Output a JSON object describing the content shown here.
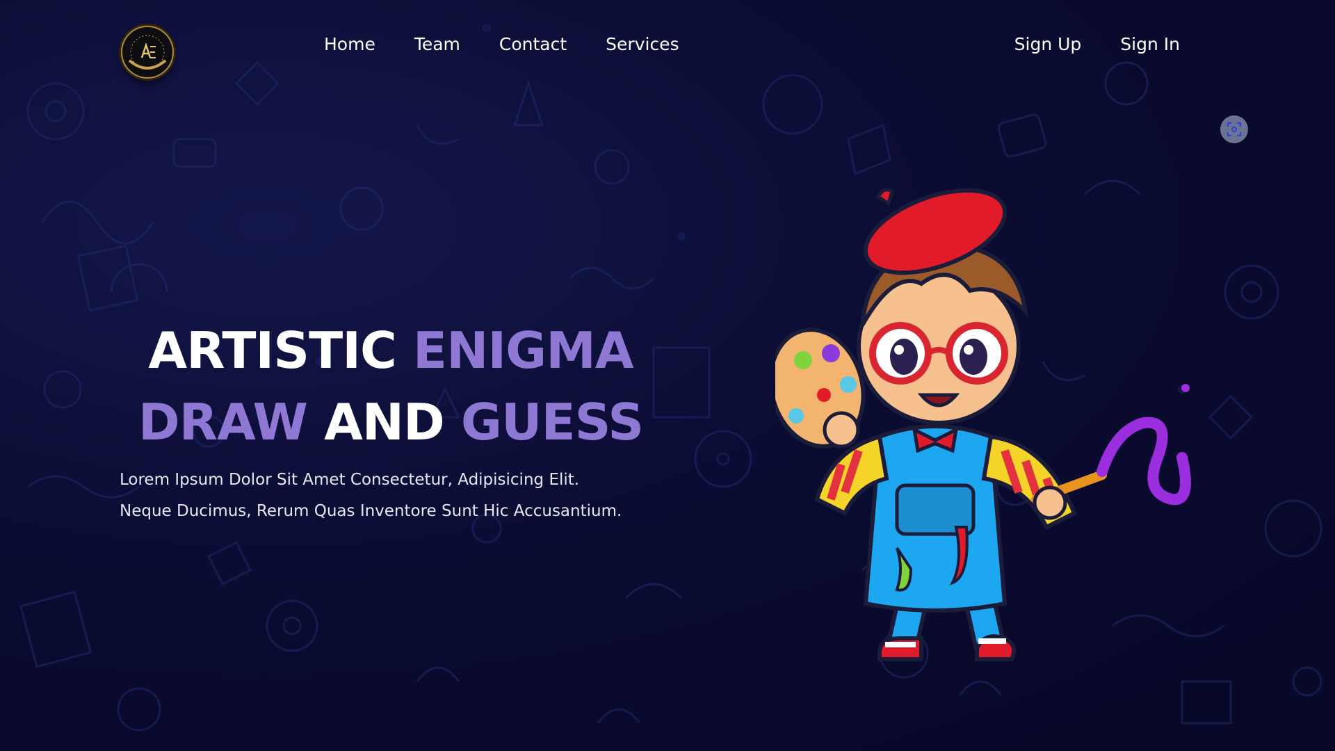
{
  "header": {
    "logo_alt": "Artistic Enigma logo",
    "logo_letters": "AE",
    "nav": [
      {
        "label": "Home"
      },
      {
        "label": "Team"
      },
      {
        "label": "Contact"
      },
      {
        "label": "Services"
      }
    ],
    "auth": {
      "sign_up": "Sign Up",
      "sign_in": "Sign In"
    }
  },
  "hero": {
    "title_line1": {
      "word1": "ARTISTIC",
      "word2": "ENIGMA"
    },
    "title_line2": {
      "word1": "DRAW",
      "word2": "AND",
      "word3": "GUESS"
    },
    "description": "Lorem Ipsum Dolor Sit Amet Consectetur, Adipisicing Elit. Neque Ducimus, Rerum Quas Inventore Sunt Hic Accusantium."
  },
  "icons": {
    "logo": "logo-icon",
    "focus": "focus-scan-icon",
    "mascot": "painter-boy-illustration"
  },
  "colors": {
    "background": "#0b0c33",
    "accent_purple": "#8f78d4",
    "text_white": "#ffffff"
  }
}
